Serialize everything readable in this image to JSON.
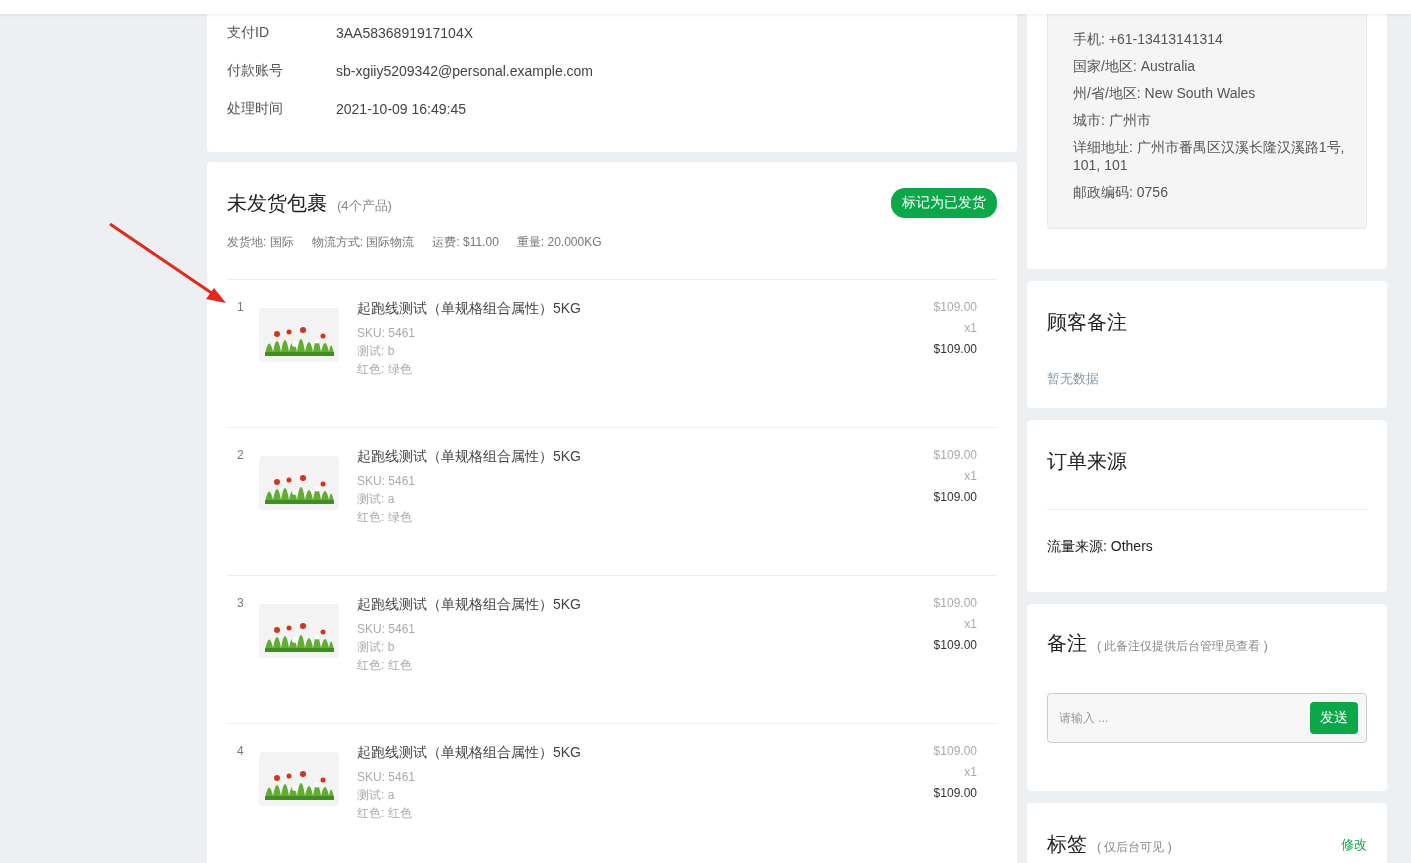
{
  "payment": {
    "rows": [
      {
        "label": "支付ID",
        "value": "3AA5836891917104X"
      },
      {
        "label": "付款账号",
        "value": "sb-xgiiy5209342@personal.example.com"
      },
      {
        "label": "处理时间",
        "value": "2021-10-09 16:49:45"
      }
    ]
  },
  "package": {
    "title": "未发货包裹",
    "count": "(4个产品)",
    "button": "标记为已发货",
    "meta": [
      "发货地: 国际",
      "物流方式: 国际物流",
      "运费: $11.00",
      "重量: 20.000KG"
    ],
    "items": [
      {
        "index": "1",
        "name": "起跑线测试（单规格组合属性）5KG",
        "attrs": [
          "SKU: 5461",
          "测试: b",
          "红色: 绿色"
        ],
        "price": "$109.00",
        "qty": "x1",
        "total": "$109.00"
      },
      {
        "index": "2",
        "name": "起跑线测试（单规格组合属性）5KG",
        "attrs": [
          "SKU: 5461",
          "测试: a",
          "红色: 绿色"
        ],
        "price": "$109.00",
        "qty": "x1",
        "total": "$109.00"
      },
      {
        "index": "3",
        "name": "起跑线测试（单规格组合属性）5KG",
        "attrs": [
          "SKU: 5461",
          "测试: b",
          "红色: 红色"
        ],
        "price": "$109.00",
        "qty": "x1",
        "total": "$109.00"
      },
      {
        "index": "4",
        "name": "起跑线测试（单规格组合属性）5KG",
        "attrs": [
          "SKU: 5461",
          "测试: a",
          "红色: 红色"
        ],
        "price": "$109.00",
        "qty": "x1",
        "total": "$109.00"
      }
    ]
  },
  "address": {
    "lines": [
      "手机: +61-13413141314",
      "国家/地区: Australia",
      "州/省/地区: New South Wales",
      "城市: 广州市",
      "详细地址: 广州市番禺区汉溪长隆汉溪路1号, 101, 101",
      "邮政编码: 0756"
    ]
  },
  "customer_note": {
    "title": "顾客备注",
    "empty": "暂无数据"
  },
  "order_source": {
    "title": "订单来源",
    "source": "流量来源: Others"
  },
  "remark": {
    "title": "备注",
    "hint": "( 此备注仅提供后台管理员查看 )",
    "placeholder": "请输入 ...",
    "button": "发送"
  },
  "tags": {
    "title": "标签",
    "hint": "( 仅后台可见 )",
    "edit": "修改"
  }
}
